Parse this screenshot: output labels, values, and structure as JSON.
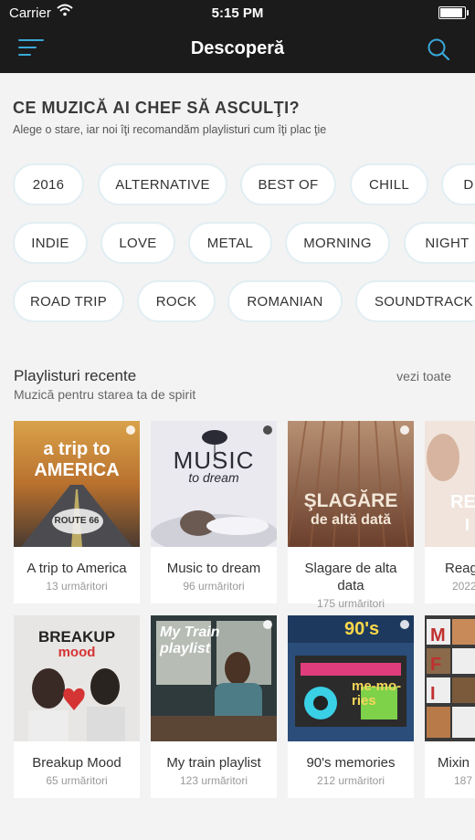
{
  "status": {
    "carrier": "Carrier",
    "time": "5:15 PM"
  },
  "header": {
    "title": "Descoperă"
  },
  "intro": {
    "title": "CE MUZICĂ AI CHEF SĂ ASCULŢI?",
    "subtitle": "Alege o stare, iar noi îţi recomandăm playlisturi cum îţi plac ţie"
  },
  "tags": [
    [
      "2016",
      "ALTERNATIVE",
      "BEST OF",
      "CHILL",
      "D"
    ],
    [
      "INDIE",
      "LOVE",
      "METAL",
      "MORNING",
      "NIGHT"
    ],
    [
      "ROAD TRIP",
      "ROCK",
      "ROMANIAN",
      "SOUNDTRACK"
    ]
  ],
  "playlists": {
    "title": "Playlisturi recente",
    "subtitle": "Muzică pentru starea ta de spirit",
    "see_all": "vezi toate",
    "cards": [
      {
        "name": "A trip to America",
        "followers": "13 urmăritori",
        "art_text": "a trip to AMERICA",
        "art_sub": "ROUTE 66"
      },
      {
        "name": "Music to dream",
        "followers": "96 urmăritori",
        "art_text": "MUSIC",
        "art_sub": "to dream"
      },
      {
        "name": "Slagare de alta data",
        "followers": "175 urmăritori",
        "art_text": "ŞLAGĂRE",
        "art_sub": "de altă dată"
      },
      {
        "name": "Reag",
        "followers": "2022",
        "art_text": "RE",
        "art_sub": "I"
      },
      {
        "name": "Breakup Mood",
        "followers": "65 urmăritori",
        "art_text": "BREAKUP",
        "art_sub": "mood"
      },
      {
        "name": "My train playlist",
        "followers": "123 urmăritori",
        "art_text": "My Train",
        "art_sub": "playlist"
      },
      {
        "name": "90's memories",
        "followers": "212 urmăritori",
        "art_text": "90's",
        "art_sub": "me-mo-ries"
      },
      {
        "name": "Mixin",
        "followers": "187",
        "art_text": "M F I",
        "art_sub": ""
      }
    ]
  },
  "colors": {
    "accent": "#3aa8d8",
    "header_bg": "#1b1b1b",
    "page_bg": "#f3f3f3"
  }
}
